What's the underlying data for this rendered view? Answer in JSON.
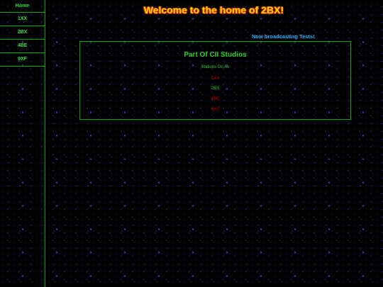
{
  "nav": {
    "items": [
      {
        "label": "Home"
      },
      {
        "label": "1XX"
      },
      {
        "label": "2BX"
      },
      {
        "label": "4BE"
      },
      {
        "label": "9XF"
      }
    ]
  },
  "header": {
    "title": "Welcome to the home of 2BX!"
  },
  "status": {
    "broadcast": "Now broadcasting Tests!"
  },
  "studio": {
    "title": "Part Of CII Studios",
    "on_air_label": "Stations On Air",
    "stations": [
      {
        "label": "1XX",
        "color": "#cc0000"
      },
      {
        "label": "2BX",
        "color": "#33cc33"
      },
      {
        "label": "4BE",
        "color": "#cc0000"
      },
      {
        "label": "9XF",
        "color": "#cc0000"
      }
    ]
  },
  "colors": {
    "background": "#000000",
    "accent_green": "#33cc33",
    "border_green": "#00aa00",
    "title_yellow": "#ffd300",
    "broadcast_blue": "#2fb3ff",
    "offline_red": "#cc0000"
  }
}
